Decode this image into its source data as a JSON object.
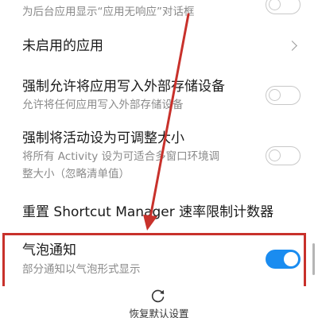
{
  "settings": {
    "items": [
      {
        "subtitle": "为后台应用显示“应用无响应”对话框"
      },
      {
        "title": "未启用的应用"
      },
      {
        "title": "强制允许将应用写入外部存储设备",
        "subtitle": "允许将任何应用写入外部存储设备"
      },
      {
        "title": "强制将活动设为可调整大小",
        "subtitle_line1": "将所有 Activity 设为可适合多窗口环境调",
        "subtitle_line2": "整大小（忽略清单值）"
      },
      {
        "title": "重置 Shortcut Manager 速率限制计数器"
      },
      {
        "title": "气泡通知",
        "subtitle": "部分通知以气泡形式显示"
      }
    ]
  },
  "bottom": {
    "reset_label": "恢复默认设置"
  },
  "colors": {
    "accent": "#1a8cf0",
    "annotation": "#c8312b"
  },
  "icons": {
    "chevron": "chevron-right-icon",
    "reset": "reset-icon"
  }
}
